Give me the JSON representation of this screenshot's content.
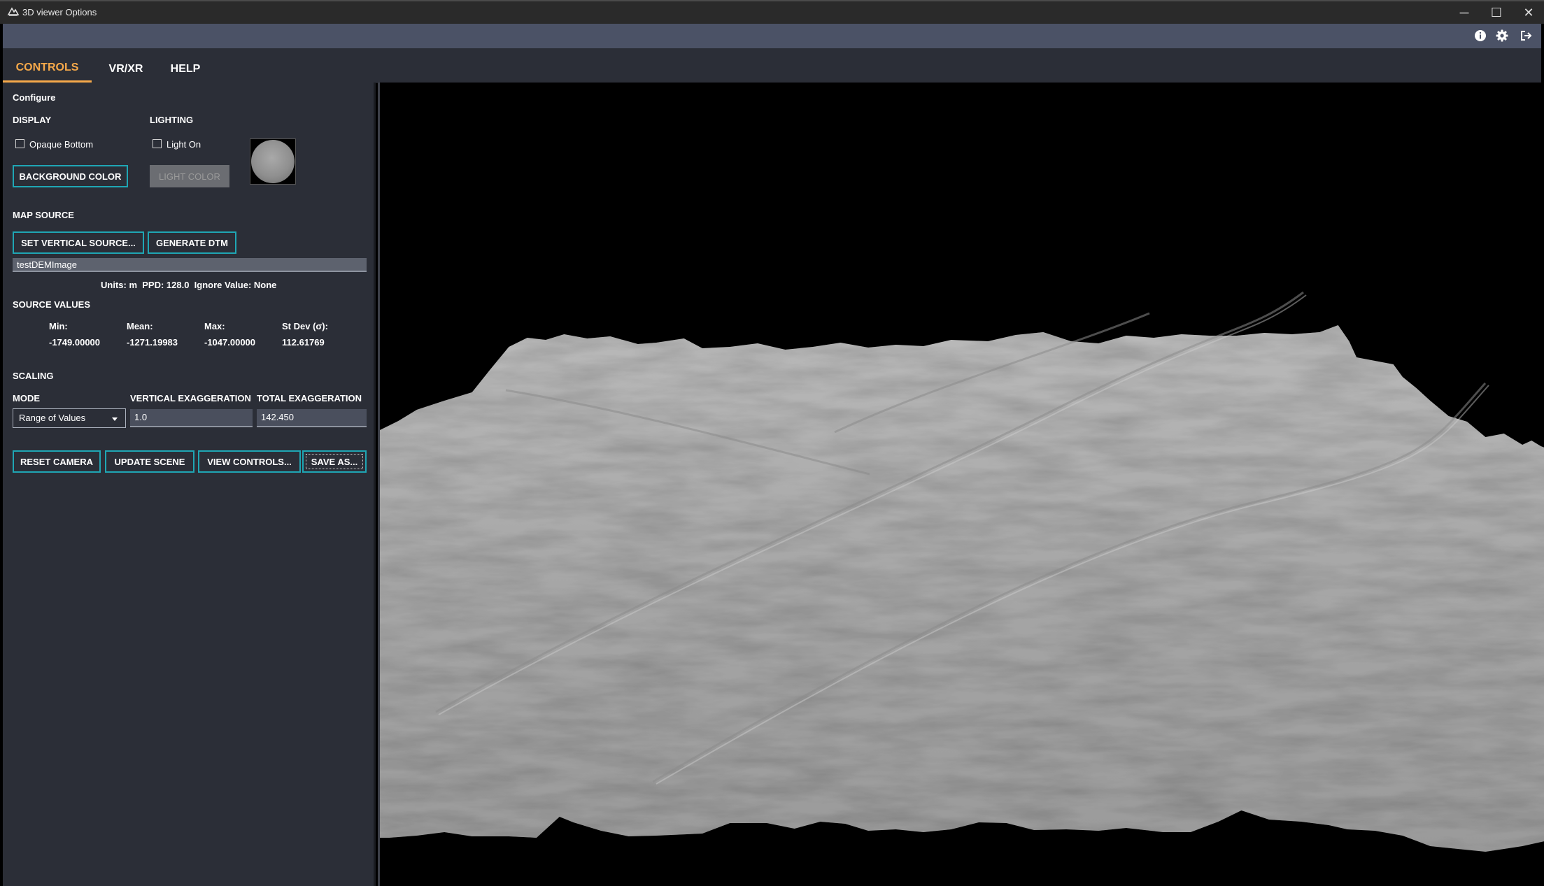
{
  "window": {
    "title": "3D viewer Options",
    "controls": {
      "minimize": "─",
      "maximize": "☐",
      "close": "✕"
    }
  },
  "toolbar": {
    "icons": [
      "info-icon",
      "gear-icon",
      "exit-icon"
    ]
  },
  "tabs": [
    {
      "label": "CONTROLS",
      "active": true
    },
    {
      "label": "VR/XR",
      "active": false
    },
    {
      "label": "HELP",
      "active": false
    }
  ],
  "panel": {
    "configure_title": "Configure",
    "display": {
      "heading": "DISPLAY",
      "opaque_bottom_label": "Opaque Bottom",
      "opaque_bottom_checked": false,
      "background_color_button": "BACKGROUND COLOR"
    },
    "lighting": {
      "heading": "LIGHTING",
      "light_on_label": "Light On",
      "light_on_checked": false,
      "light_color_button": "LIGHT COLOR"
    },
    "map_source": {
      "heading": "MAP SOURCE",
      "set_vertical_source_button": "SET VERTICAL SOURCE...",
      "generate_dtm_button": "GENERATE DTM",
      "source_name": "testDEMImage",
      "info_line": "Units: m  PPD: 128.0  Ignore Value: None"
    },
    "source_values": {
      "heading": "SOURCE VALUES",
      "min_label": "Min:",
      "min_value": "-1749.00000",
      "mean_label": "Mean:",
      "mean_value": "-1271.19983",
      "max_label": "Max:",
      "max_value": "-1047.00000",
      "stdev_label": "St Dev (σ):",
      "stdev_value": "112.61769"
    },
    "scaling": {
      "heading": "SCALING",
      "mode_label": "MODE",
      "mode_value": "Range of Values",
      "vertical_exaggeration_label": "VERTICAL EXAGGERATION",
      "vertical_exaggeration_value": "1.0",
      "total_exaggeration_label": "TOTAL EXAGGERATION",
      "total_exaggeration_value": "142.450"
    },
    "actions": {
      "reset_camera": "RESET CAMERA",
      "update_scene": "UPDATE SCENE",
      "view_controls": "VIEW CONTROLS...",
      "save_as": "SAVE AS..."
    }
  },
  "colors": {
    "accent_tab": "#f6a94a",
    "button_border": "#1fa6b4",
    "panel_bg": "#2b2e37",
    "toolbar_bg": "#4b5266",
    "terrain": "#a8a8a8"
  }
}
